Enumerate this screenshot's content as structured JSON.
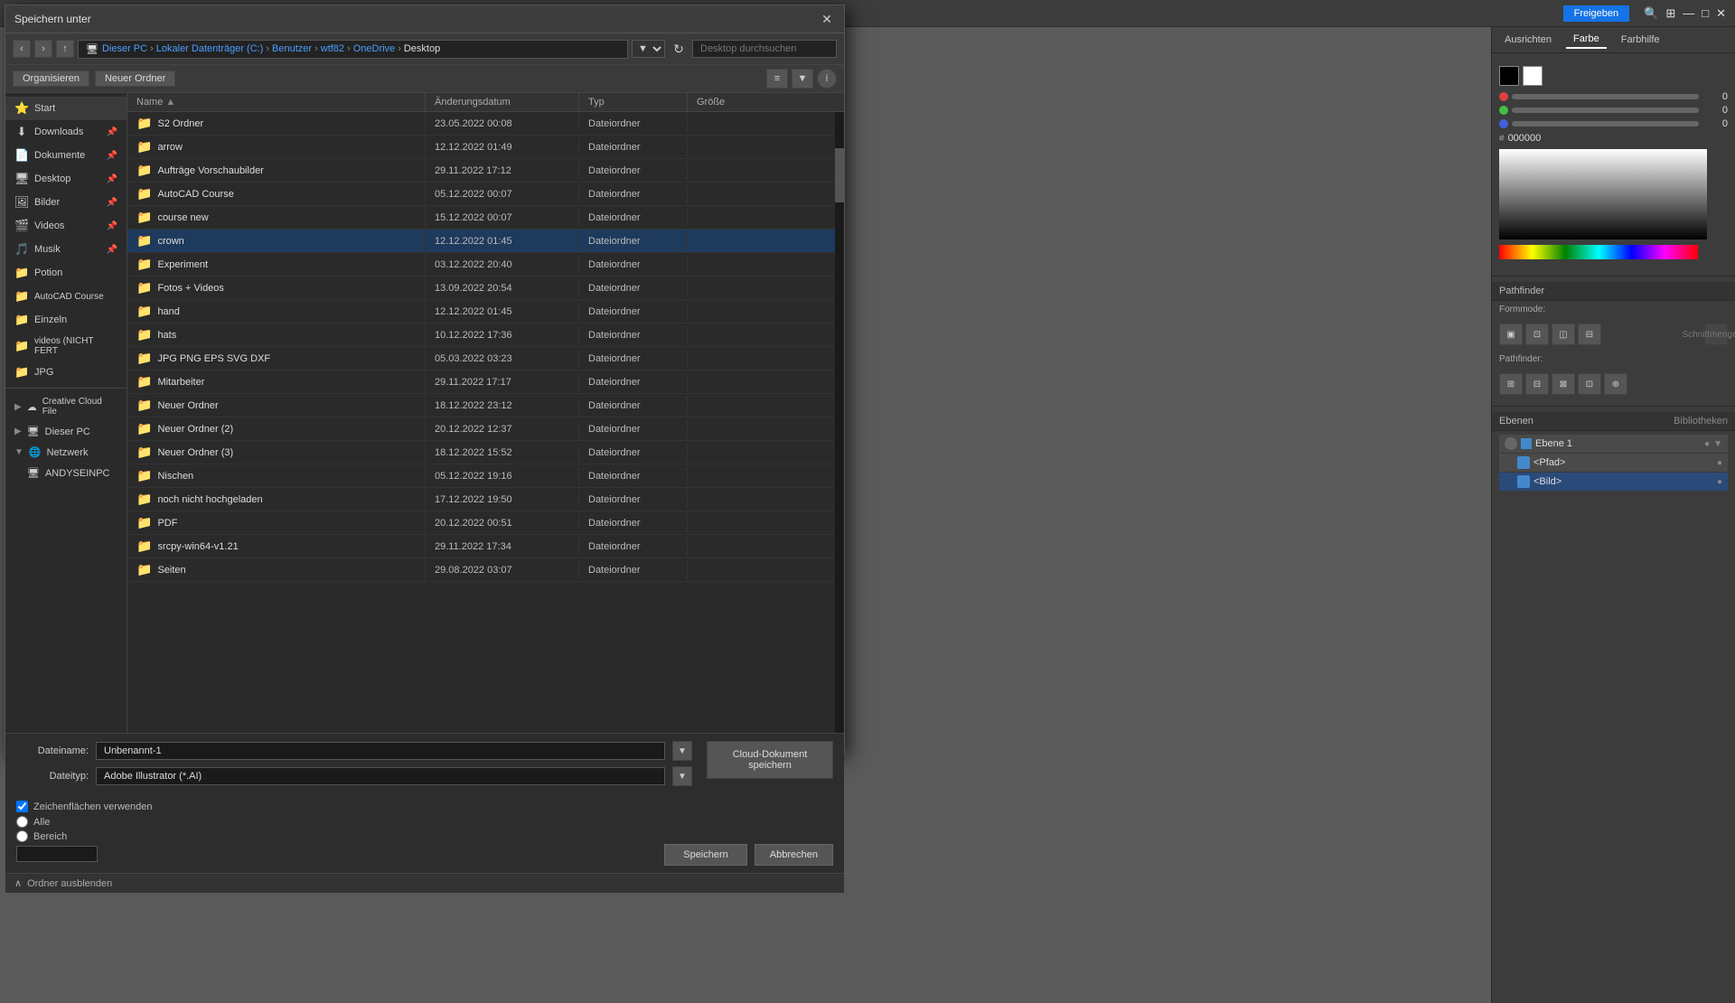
{
  "dialog": {
    "title": "Speichern unter",
    "close_label": "✕"
  },
  "breadcrumb": {
    "items": [
      "Dieser PC",
      "Lokaler Datenträger (C:)",
      "Benutzer",
      "wtf82",
      "OneDrive",
      "Desktop"
    ],
    "separator": "›"
  },
  "toolbar": {
    "new_folder_label": "Neuer Ordner",
    "organize_label": "Organisieren"
  },
  "search": {
    "placeholder": "Desktop durchsuchen"
  },
  "file_list": {
    "columns": [
      "Name",
      "Änderungsdatum",
      "Typ",
      "Größe"
    ],
    "rows": [
      {
        "name": "S2 Ordner",
        "date": "23.05.2022 00:08",
        "type": "Dateiordner",
        "size": ""
      },
      {
        "name": "arrow",
        "date": "12.12.2022 01:49",
        "type": "Dateiordner",
        "size": ""
      },
      {
        "name": "Aufträge Vorschaubilder",
        "date": "29.11.2022 17:12",
        "type": "Dateiordner",
        "size": ""
      },
      {
        "name": "AutoCAD Course",
        "date": "05.12.2022 00:07",
        "type": "Dateiordner",
        "size": ""
      },
      {
        "name": "course new",
        "date": "15.12.2022 00:07",
        "type": "Dateiordner",
        "size": ""
      },
      {
        "name": "crown",
        "date": "12.12.2022 01:45",
        "type": "Dateiordner",
        "size": ""
      },
      {
        "name": "Experiment",
        "date": "03.12.2022 20:40",
        "type": "Dateiordner",
        "size": ""
      },
      {
        "name": "Fotos + Videos",
        "date": "13.09.2022 20:54",
        "type": "Dateiordner",
        "size": ""
      },
      {
        "name": "hand",
        "date": "12.12.2022 01:45",
        "type": "Dateiordner",
        "size": ""
      },
      {
        "name": "hats",
        "date": "10.12.2022 17:36",
        "type": "Dateiordner",
        "size": ""
      },
      {
        "name": "JPG PNG EPS SVG DXF",
        "date": "05.03.2022 03:23",
        "type": "Dateiordner",
        "size": ""
      },
      {
        "name": "Mitarbeiter",
        "date": "29.11.2022 17:17",
        "type": "Dateiordner",
        "size": ""
      },
      {
        "name": "Neuer Ordner",
        "date": "18.12.2022 23:12",
        "type": "Dateiordner",
        "size": ""
      },
      {
        "name": "Neuer Ordner (2)",
        "date": "20.12.2022 12:37",
        "type": "Dateiordner",
        "size": ""
      },
      {
        "name": "Neuer Ordner (3)",
        "date": "18.12.2022 15:52",
        "type": "Dateiordner",
        "size": ""
      },
      {
        "name": "Nischen",
        "date": "05.12.2022 19:16",
        "type": "Dateiordner",
        "size": ""
      },
      {
        "name": "noch nicht hochgeladen",
        "date": "17.12.2022 19:50",
        "type": "Dateiordner",
        "size": ""
      },
      {
        "name": "PDF",
        "date": "20.12.2022 00:51",
        "type": "Dateiordner",
        "size": ""
      },
      {
        "name": "srcpy-win64-v1.21",
        "date": "29.11.2022 17:34",
        "type": "Dateiordner",
        "size": ""
      },
      {
        "name": "Seiten",
        "date": "29.08.2022 03:07",
        "type": "Dateiordner",
        "size": ""
      }
    ]
  },
  "bottom": {
    "filename_label": "Dateiname:",
    "filename_value": "Unbenannt-1",
    "filetype_label": "Dateityp:",
    "filetype_value": "Adobe Illustrator (*.AI)",
    "cloud_save_label": "Cloud-Dokument\nspeichern",
    "checkbox_label": "Zeichenflächen\nverwenden",
    "radio_all_label": "Alle",
    "radio_range_label": "Bereich",
    "save_label": "Speichern",
    "cancel_label": "Abbrechen",
    "folder_toggle_label": "Ordner ausblenden"
  },
  "sidebar": {
    "items": [
      {
        "label": "Start",
        "icon": "⭐",
        "pin": false
      },
      {
        "label": "Downloads",
        "icon": "⬇",
        "pin": true
      },
      {
        "label": "Dokumente",
        "icon": "📄",
        "pin": true
      },
      {
        "label": "Desktop",
        "icon": "🖥",
        "pin": true
      },
      {
        "label": "Bilder",
        "icon": "🖼",
        "pin": true
      },
      {
        "label": "Videos",
        "icon": "🎬",
        "pin": true
      },
      {
        "label": "Musik",
        "icon": "🎵",
        "pin": true
      },
      {
        "label": "Potion",
        "icon": "📁",
        "pin": false
      },
      {
        "label": "AutoCAD Course",
        "icon": "📁",
        "pin": false
      },
      {
        "label": "Einzeln",
        "icon": "📁",
        "pin": false
      },
      {
        "label": "videos (NICHT FERT",
        "icon": "📁",
        "pin": false
      },
      {
        "label": "JPG",
        "icon": "📁",
        "pin": false
      }
    ],
    "groups": [
      {
        "label": "Creative Cloud File",
        "icon": "☁",
        "expanded": false,
        "indent": false
      },
      {
        "label": "Dieser PC",
        "icon": "🖥",
        "expanded": false,
        "indent": false
      },
      {
        "label": "Netzwerk",
        "icon": "🌐",
        "expanded": true,
        "indent": false
      },
      {
        "label": "ANDYSEINPC",
        "icon": "🖥",
        "expanded": false,
        "indent": true
      }
    ]
  },
  "right_panel": {
    "tabs": [
      "Ausrichten",
      "Farbe",
      "Farbhilfe"
    ],
    "active_tab": "Farbe",
    "rgb": {
      "r": 0,
      "g": 0,
      "b": 0
    },
    "hex": "000000",
    "pathfinder_label": "Pathfinder",
    "formmode_label": "Formmode:",
    "pathfinder2_label": "Pathfinder:",
    "ebenen_tab": "Ebenen",
    "bibliotheken_tab": "Bibliotheken",
    "layers": [
      {
        "name": "Ebene 1",
        "type": "layer",
        "selected": false
      },
      {
        "name": "<Pfad>",
        "type": "path",
        "selected": false
      },
      {
        "name": "<Bild>",
        "type": "image",
        "selected": true
      }
    ]
  },
  "ai_top": {
    "share_label": "Freigeben",
    "search_icon": "🔍"
  }
}
